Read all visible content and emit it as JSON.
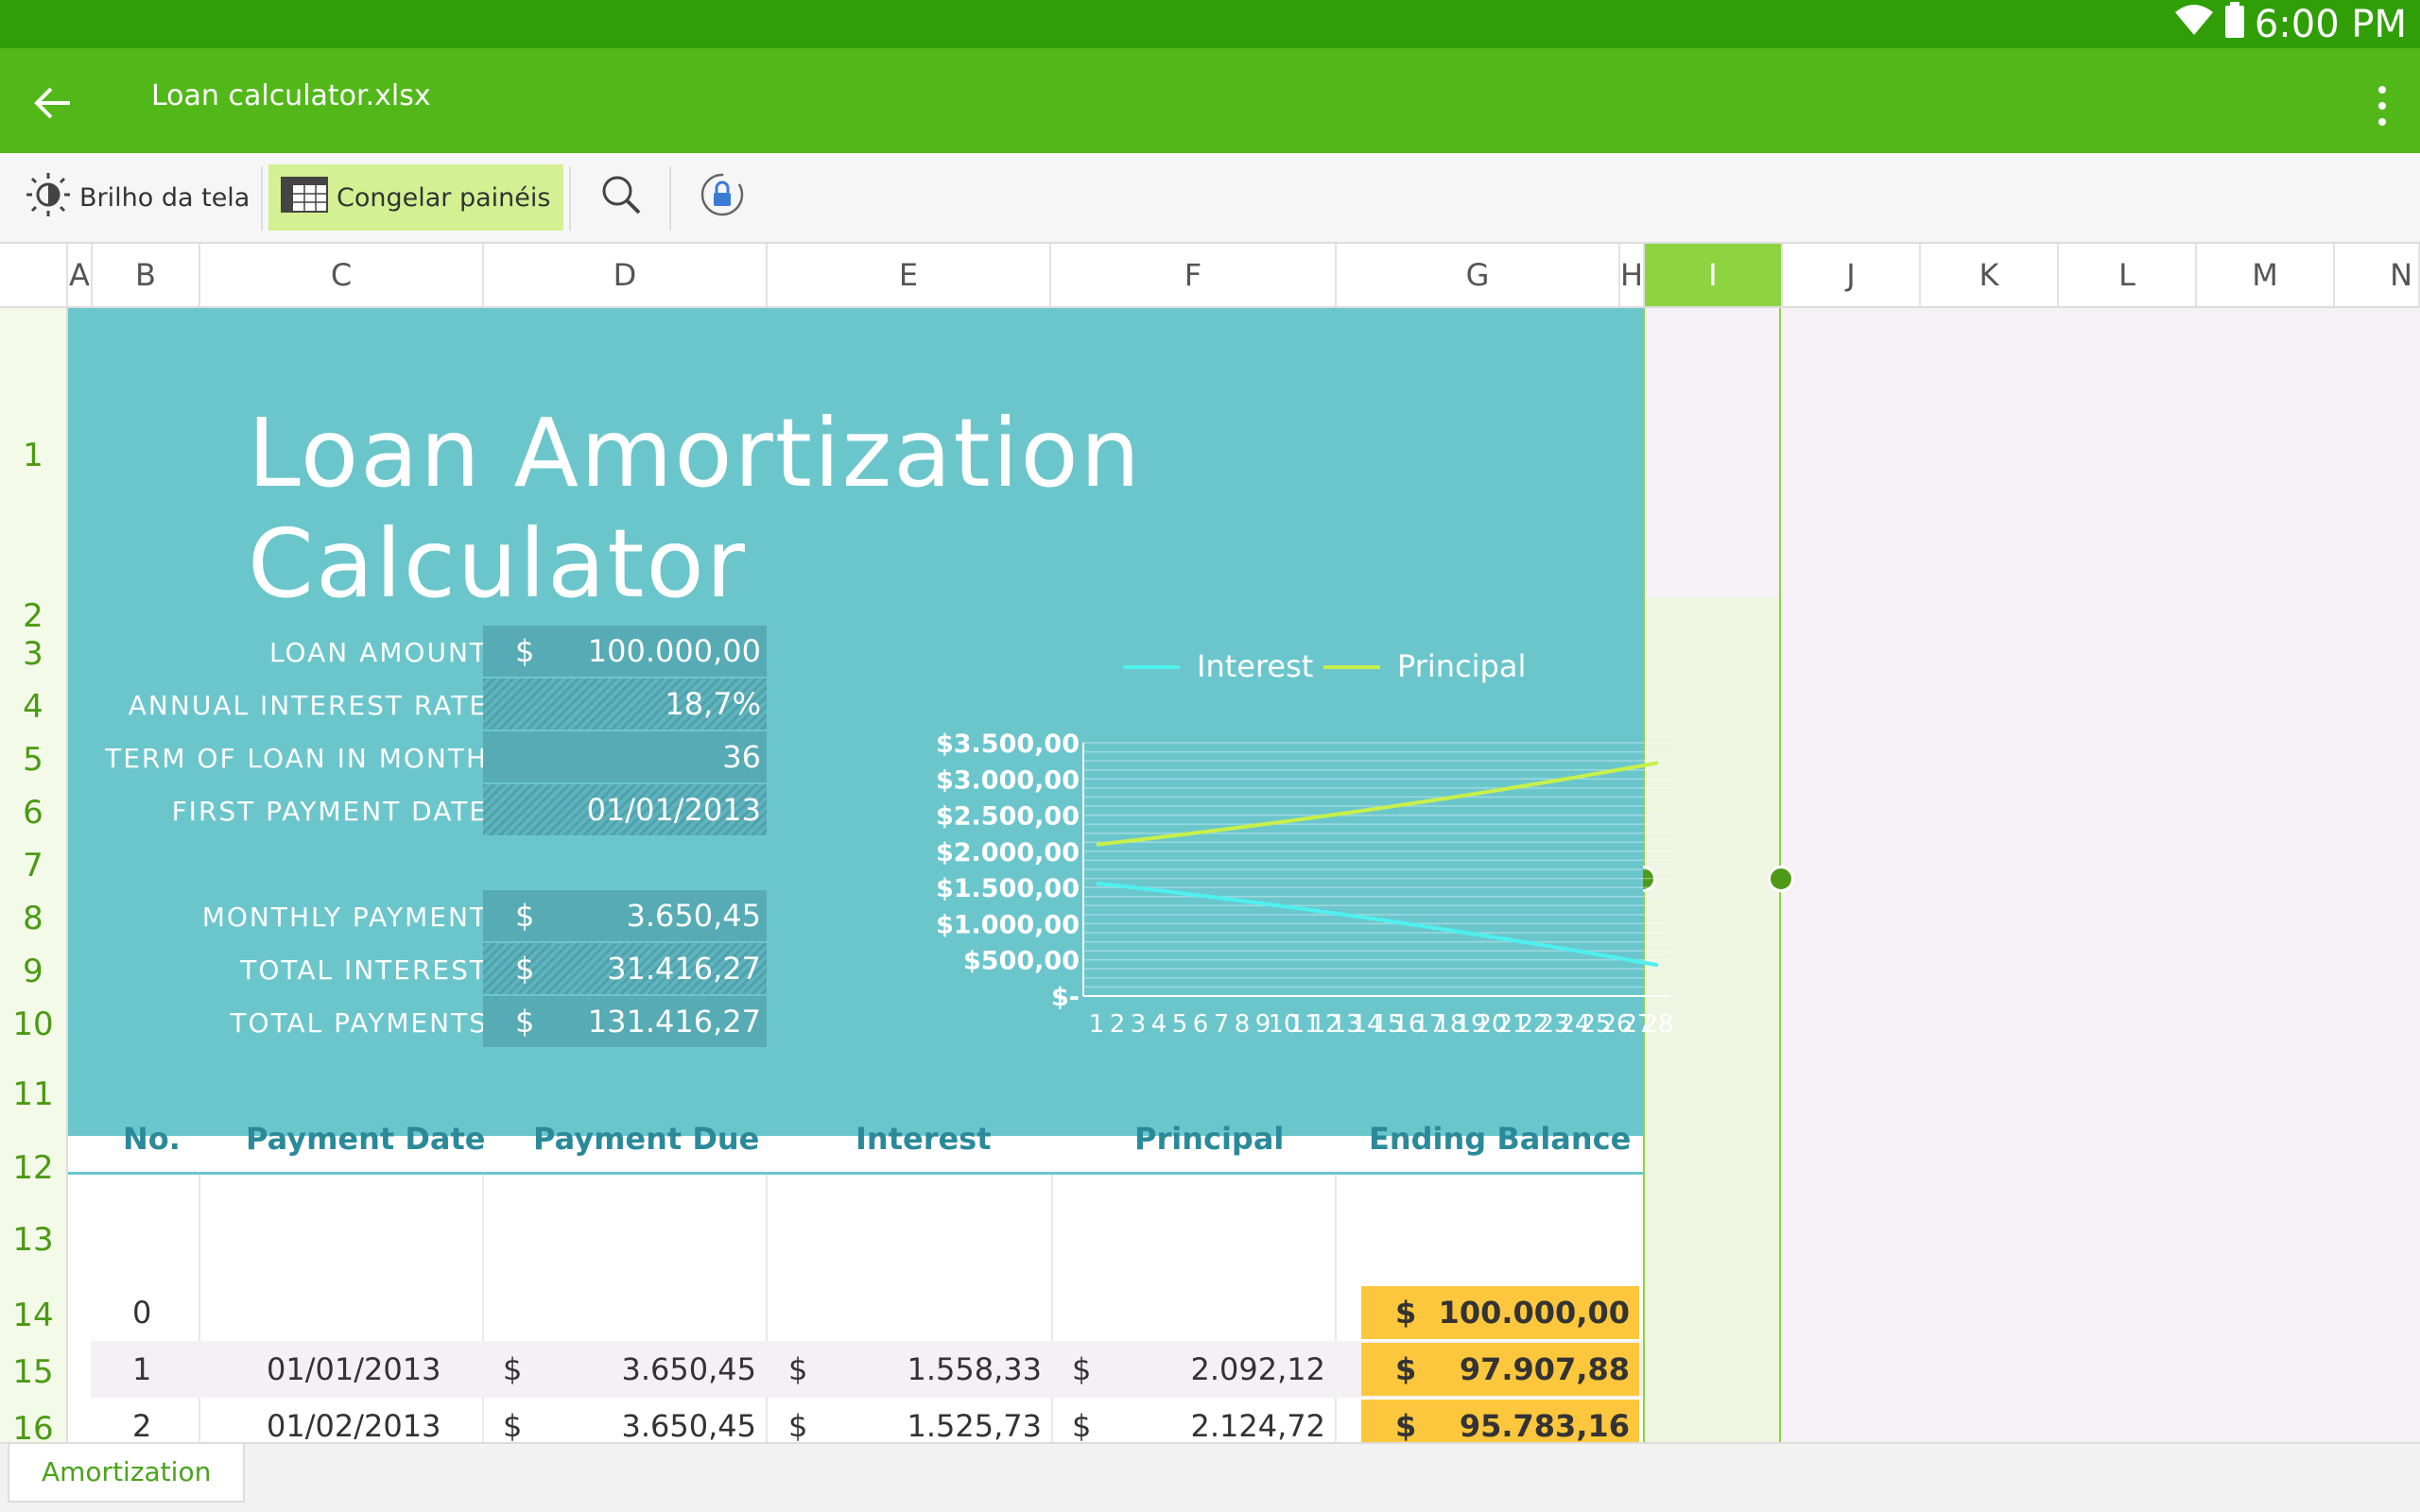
{
  "status_bar": {
    "time": "6:00 PM",
    "wifi_icon": "wifi-icon",
    "battery_icon": "battery-icon"
  },
  "app_bar": {
    "title": "Loan calculator.xlsx",
    "back_icon": "back-arrow-icon",
    "menu_icon": "more-vert-icon"
  },
  "toolbar": {
    "brightness_label": "Brilho da tela",
    "freeze_label": "Congelar painéis",
    "search_icon": "search-icon",
    "lock_icon": "rotation-lock-icon"
  },
  "columns": [
    "A",
    "B",
    "C",
    "D",
    "E",
    "F",
    "G",
    "H",
    "I",
    "J",
    "K",
    "L",
    "M",
    "N"
  ],
  "rows": [
    "1",
    "2",
    "3",
    "4",
    "5",
    "6",
    "7",
    "8",
    "9",
    "10",
    "11",
    "12",
    "13",
    "14",
    "15",
    "16"
  ],
  "sheet": {
    "title": "Loan Amortization Calculator",
    "inputs": [
      {
        "label": "LOAN AMOUNT",
        "currency": "$",
        "value": "100.000,00"
      },
      {
        "label": "ANNUAL INTEREST RATE",
        "currency": "",
        "value": "18,7%"
      },
      {
        "label": "TERM OF LOAN IN MONTH",
        "currency": "",
        "value": "36"
      },
      {
        "label": "FIRST PAYMENT DATE",
        "currency": "",
        "value": "01/01/2013"
      }
    ],
    "outputs": [
      {
        "label": "MONTHLY PAYMENT",
        "currency": "$",
        "value": "3.650,45"
      },
      {
        "label": "TOTAL INTEREST",
        "currency": "$",
        "value": "31.416,27"
      },
      {
        "label": "TOTAL PAYMENTS",
        "currency": "$",
        "value": "131.416,27"
      }
    ],
    "table_headers": [
      "No.",
      "Payment Date",
      "Payment Due",
      "Interest",
      "Principal",
      "Ending Balance"
    ],
    "table_rows": [
      {
        "no": "0",
        "date": "",
        "due_cur": "",
        "due": "",
        "int_cur": "",
        "interest": "",
        "pr_cur": "",
        "principal": "",
        "bal_cur": "$",
        "balance": "100.000,00"
      },
      {
        "no": "1",
        "date": "01/01/2013",
        "due_cur": "$",
        "due": "3.650,45",
        "int_cur": "$",
        "interest": "1.558,33",
        "pr_cur": "$",
        "principal": "2.092,12",
        "bal_cur": "$",
        "balance": "97.907,88"
      },
      {
        "no": "2",
        "date": "01/02/2013",
        "due_cur": "$",
        "due": "3.650,45",
        "int_cur": "$",
        "interest": "1.525,73",
        "pr_cur": "$",
        "principal": "2.124,72",
        "bal_cur": "$",
        "balance": "95.783,16"
      }
    ]
  },
  "chart_data": {
    "type": "line",
    "legend": "top",
    "grid": true,
    "ylim": [
      0,
      3500
    ],
    "y_ticks": [
      "$-",
      "$500,00",
      "$1.000,00",
      "$1.500,00",
      "$2.000,00",
      "$2.500,00",
      "$3.000,00",
      "$3.500,00"
    ],
    "x": [
      1,
      2,
      3,
      4,
      5,
      6,
      7,
      8,
      9,
      10,
      11,
      12,
      13,
      14,
      15,
      16,
      17,
      18,
      19,
      20,
      21,
      22,
      23,
      24,
      25,
      26,
      27,
      28
    ],
    "series": [
      {
        "name": "Interest",
        "color": "#4ef0f0",
        "values": [
          1558,
          1526,
          1492,
          1458,
          1423,
          1388,
          1352,
          1315,
          1278,
          1240,
          1201,
          1161,
          1121,
          1080,
          1039,
          996,
          953,
          909,
          864,
          819,
          772,
          725,
          677,
          629,
          579,
          529,
          478,
          426
        ]
      },
      {
        "name": "Principal",
        "color": "#c8f04a",
        "values": [
          2092,
          2125,
          2158,
          2192,
          2227,
          2262,
          2298,
          2335,
          2372,
          2410,
          2449,
          2489,
          2529,
          2570,
          2611,
          2654,
          2697,
          2741,
          2786,
          2831,
          2878,
          2925,
          2973,
          3021,
          3071,
          3121,
          3172,
          3224
        ]
      }
    ]
  },
  "sheet_tab": {
    "label": "Amortization"
  }
}
